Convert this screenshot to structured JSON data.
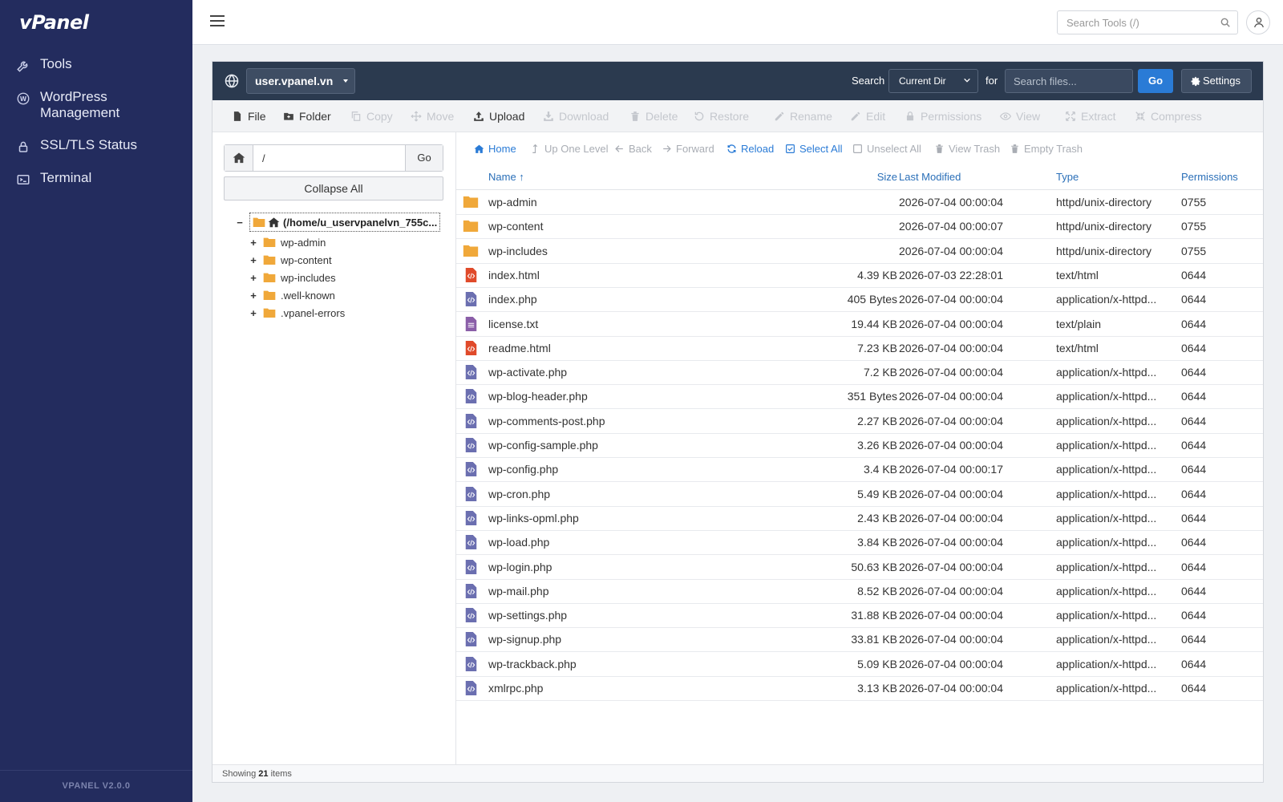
{
  "app": {
    "logo": "vPanel",
    "version": "VPANEL V2.0.0"
  },
  "sidebar": {
    "items": [
      {
        "label": "Tools",
        "icon": "wrench-icon"
      },
      {
        "label": "WordPress Management",
        "icon": "wordpress-icon"
      },
      {
        "label": "SSL/TLS Status",
        "icon": "lock-icon"
      },
      {
        "label": "Terminal",
        "icon": "terminal-icon"
      }
    ]
  },
  "topbar": {
    "search_placeholder": "Search Tools (/)"
  },
  "fm_header": {
    "domain": "user.vpanel.vn",
    "search_label": "Search",
    "scope": "Current Dir",
    "for_label": "for",
    "search_placeholder": "Search files...",
    "go_label": "Go",
    "settings_label": "Settings"
  },
  "toolbar": {
    "file": "File",
    "folder": "Folder",
    "copy": "Copy",
    "move": "Move",
    "upload": "Upload",
    "download": "Download",
    "delete": "Delete",
    "restore": "Restore",
    "rename": "Rename",
    "edit": "Edit",
    "permissions": "Permissions",
    "view": "View",
    "extract": "Extract",
    "compress": "Compress"
  },
  "tree_pane": {
    "path_value": "/",
    "go_label": "Go",
    "collapse_label": "Collapse All",
    "root_label": "(/home/u_uservpanelvn_755c...",
    "items": [
      "wp-admin",
      "wp-content",
      "wp-includes",
      ".well-known",
      ".vpanel-errors"
    ]
  },
  "list_toolbar": {
    "home": "Home",
    "up": "Up One Level",
    "back": "Back",
    "forward": "Forward",
    "reload": "Reload",
    "select_all": "Select All",
    "unselect_all": "Unselect All",
    "view_trash": "View Trash",
    "empty_trash": "Empty Trash"
  },
  "columns": {
    "name": "Name ↑",
    "size": "Size",
    "modified": "Last Modified",
    "type": "Type",
    "permissions": "Permissions"
  },
  "files": [
    {
      "name": "wp-admin",
      "size": "",
      "modified": "2026-07-04 00:00:04",
      "type": "httpd/unix-directory",
      "perm": "0755",
      "kind": "folder"
    },
    {
      "name": "wp-content",
      "size": "",
      "modified": "2026-07-04 00:00:07",
      "type": "httpd/unix-directory",
      "perm": "0755",
      "kind": "folder"
    },
    {
      "name": "wp-includes",
      "size": "",
      "modified": "2026-07-04 00:00:04",
      "type": "httpd/unix-directory",
      "perm": "0755",
      "kind": "folder"
    },
    {
      "name": "index.html",
      "size": "4.39 KB",
      "modified": "2026-07-03 22:28:01",
      "type": "text/html",
      "perm": "0644",
      "kind": "html"
    },
    {
      "name": "index.php",
      "size": "405 Bytes",
      "modified": "2026-07-04 00:00:04",
      "type": "application/x-httpd...",
      "perm": "0644",
      "kind": "php"
    },
    {
      "name": "license.txt",
      "size": "19.44 KB",
      "modified": "2026-07-04 00:00:04",
      "type": "text/plain",
      "perm": "0644",
      "kind": "text"
    },
    {
      "name": "readme.html",
      "size": "7.23 KB",
      "modified": "2026-07-04 00:00:04",
      "type": "text/html",
      "perm": "0644",
      "kind": "html"
    },
    {
      "name": "wp-activate.php",
      "size": "7.2 KB",
      "modified": "2026-07-04 00:00:04",
      "type": "application/x-httpd...",
      "perm": "0644",
      "kind": "php"
    },
    {
      "name": "wp-blog-header.php",
      "size": "351 Bytes",
      "modified": "2026-07-04 00:00:04",
      "type": "application/x-httpd...",
      "perm": "0644",
      "kind": "php"
    },
    {
      "name": "wp-comments-post.php",
      "size": "2.27 KB",
      "modified": "2026-07-04 00:00:04",
      "type": "application/x-httpd...",
      "perm": "0644",
      "kind": "php"
    },
    {
      "name": "wp-config-sample.php",
      "size": "3.26 KB",
      "modified": "2026-07-04 00:00:04",
      "type": "application/x-httpd...",
      "perm": "0644",
      "kind": "php"
    },
    {
      "name": "wp-config.php",
      "size": "3.4 KB",
      "modified": "2026-07-04 00:00:17",
      "type": "application/x-httpd...",
      "perm": "0644",
      "kind": "php"
    },
    {
      "name": "wp-cron.php",
      "size": "5.49 KB",
      "modified": "2026-07-04 00:00:04",
      "type": "application/x-httpd...",
      "perm": "0644",
      "kind": "php"
    },
    {
      "name": "wp-links-opml.php",
      "size": "2.43 KB",
      "modified": "2026-07-04 00:00:04",
      "type": "application/x-httpd...",
      "perm": "0644",
      "kind": "php"
    },
    {
      "name": "wp-load.php",
      "size": "3.84 KB",
      "modified": "2026-07-04 00:00:04",
      "type": "application/x-httpd...",
      "perm": "0644",
      "kind": "php"
    },
    {
      "name": "wp-login.php",
      "size": "50.63 KB",
      "modified": "2026-07-04 00:00:04",
      "type": "application/x-httpd...",
      "perm": "0644",
      "kind": "php"
    },
    {
      "name": "wp-mail.php",
      "size": "8.52 KB",
      "modified": "2026-07-04 00:00:04",
      "type": "application/x-httpd...",
      "perm": "0644",
      "kind": "php"
    },
    {
      "name": "wp-settings.php",
      "size": "31.88 KB",
      "modified": "2026-07-04 00:00:04",
      "type": "application/x-httpd...",
      "perm": "0644",
      "kind": "php"
    },
    {
      "name": "wp-signup.php",
      "size": "33.81 KB",
      "modified": "2026-07-04 00:00:04",
      "type": "application/x-httpd...",
      "perm": "0644",
      "kind": "php"
    },
    {
      "name": "wp-trackback.php",
      "size": "5.09 KB",
      "modified": "2026-07-04 00:00:04",
      "type": "application/x-httpd...",
      "perm": "0644",
      "kind": "php"
    },
    {
      "name": "xmlrpc.php",
      "size": "3.13 KB",
      "modified": "2026-07-04 00:00:04",
      "type": "application/x-httpd...",
      "perm": "0644",
      "kind": "php"
    }
  ],
  "footer": {
    "prefix": "Showing",
    "count": "21",
    "suffix": "items"
  },
  "colors": {
    "sidebar": "#232c5e",
    "header": "#2b3a4f",
    "accent": "#2a7bd6",
    "folder": "#f0a83a",
    "html_icon": "#e04a2a",
    "php_icon": "#6b6fb0",
    "text_icon": "#8a5ea8"
  }
}
